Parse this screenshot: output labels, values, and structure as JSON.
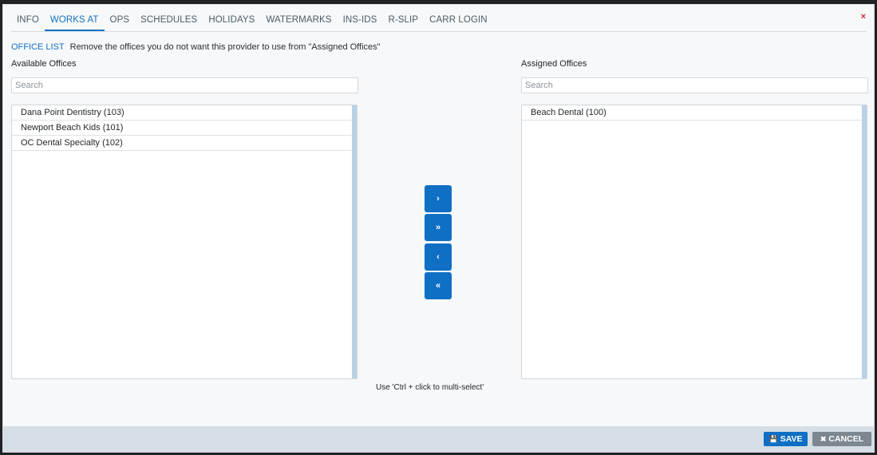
{
  "tabs": [
    {
      "label": "INFO"
    },
    {
      "label": "WORKS AT"
    },
    {
      "label": "OPS"
    },
    {
      "label": "SCHEDULES"
    },
    {
      "label": "HOLIDAYS"
    },
    {
      "label": "WATERMARKS"
    },
    {
      "label": "INS-IDS"
    },
    {
      "label": "R-SLIP"
    },
    {
      "label": "CARR LOGIN"
    }
  ],
  "active_tab": "WORKS AT",
  "close_label": "×",
  "office_list": {
    "title": "OFFICE LIST",
    "instruction": "Remove the offices you do not want this provider to use from \"Assigned Offices\""
  },
  "available": {
    "label": "Available Offices",
    "search_placeholder": "Search",
    "items": [
      "Dana Point Dentistry (103)",
      "Newport Beach Kids (101)",
      "OC Dental Specialty (102)"
    ]
  },
  "assigned": {
    "label": "Assigned Offices",
    "search_placeholder": "Search",
    "items": [
      "Beach Dental (100)"
    ]
  },
  "move_buttons": {
    "move_right": "›",
    "move_all_right": "»",
    "move_left": "‹",
    "move_all_left": "«"
  },
  "hint": "Use 'Ctrl + click to multi-select'",
  "footer": {
    "save_label": "SAVE",
    "cancel_label": "CANCEL"
  },
  "colors": {
    "accent": "#0f6fc4",
    "close": "#d7223b",
    "footer_bg": "#d5dde5",
    "cancel_bg": "#7c8790"
  }
}
